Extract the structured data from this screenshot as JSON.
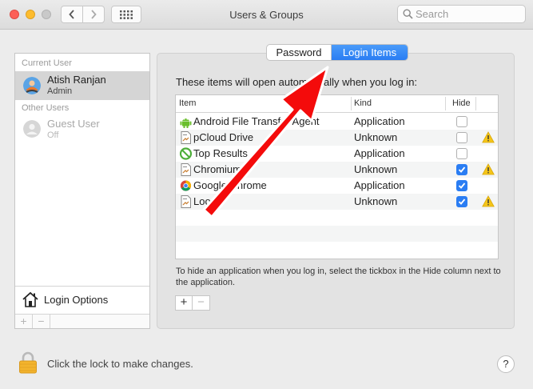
{
  "window": {
    "title": "Users & Groups"
  },
  "search": {
    "placeholder": "Search"
  },
  "sidebar": {
    "current_user_heading": "Current User",
    "current_user": {
      "name": "Atish Ranjan",
      "role": "Admin"
    },
    "other_users_heading": "Other Users",
    "other_users": [
      {
        "name": "Guest User",
        "status": "Off"
      }
    ],
    "login_options_label": "Login Options",
    "add_label": "+",
    "remove_label": "−"
  },
  "tabs": [
    {
      "label": "Password",
      "selected": false
    },
    {
      "label": "Login Items",
      "selected": true
    }
  ],
  "main": {
    "description": "These items will open automatically when you log in:",
    "columns": {
      "item": "Item",
      "kind": "Kind",
      "hide": "Hide"
    },
    "rows": [
      {
        "item": "Android File Transfer Agent",
        "kind": "Application",
        "hide": false,
        "warning": false,
        "icon": "android-icon"
      },
      {
        "item": "pCloud Drive",
        "kind": "Unknown",
        "hide": false,
        "warning": true,
        "icon": "document-icon"
      },
      {
        "item": "Top Results",
        "kind": "Application",
        "hide": false,
        "warning": false,
        "icon": "green-circle-icon"
      },
      {
        "item": "Chromium",
        "kind": "Unknown",
        "hide": true,
        "warning": true,
        "icon": "document-icon"
      },
      {
        "item": "Google Chrome",
        "kind": "Application",
        "hide": true,
        "warning": false,
        "icon": "chrome-icon"
      },
      {
        "item": "Loom",
        "kind": "Unknown",
        "hide": true,
        "warning": true,
        "icon": "document-icon"
      }
    ],
    "hint": "To hide an application when you log in, select the tickbox in the Hide column next to the application.",
    "add_label": "+",
    "remove_label": "−"
  },
  "footer": {
    "lock_text": "Click the lock to make changes.",
    "help_label": "?"
  },
  "colors": {
    "accent": "#2a7df3",
    "annotation_arrow": "#f40b0b",
    "warning": "#f5c518"
  }
}
